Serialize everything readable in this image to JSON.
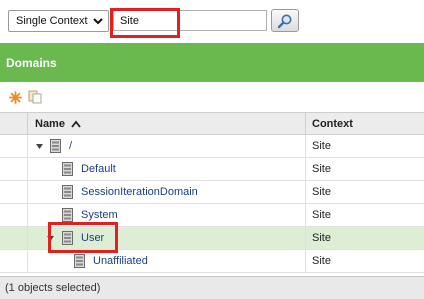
{
  "search": {
    "context_options": [
      "Single Context"
    ],
    "context_selected": "Single Context",
    "query_value": "Site",
    "button_icon": "magnifier-icon"
  },
  "panel": {
    "title": "Domains",
    "toolbar_icons": [
      "new-domain-icon",
      "copy-icon"
    ]
  },
  "table": {
    "columns": {
      "name": "Name",
      "context": "Context"
    },
    "sort": {
      "column": "Name",
      "direction": "ascending"
    },
    "rows": [
      {
        "name": "/",
        "context": "Site",
        "level": 0,
        "expanded": true,
        "selected": false
      },
      {
        "name": "Default",
        "context": "Site",
        "level": 1,
        "expanded": false,
        "selected": false
      },
      {
        "name": "SessionIterationDomain",
        "context": "Site",
        "level": 1,
        "expanded": false,
        "selected": false
      },
      {
        "name": "System",
        "context": "Site",
        "level": 1,
        "expanded": false,
        "selected": false
      },
      {
        "name": "User",
        "context": "Site",
        "level": 1,
        "expanded": true,
        "selected": true
      },
      {
        "name": "Unaffiliated",
        "context": "Site",
        "level": 2,
        "expanded": false,
        "selected": false
      }
    ]
  },
  "status": {
    "text": "(1 objects selected)"
  },
  "colors": {
    "header_green": "#6ab94e",
    "highlight_red": "#e0211f",
    "selected_row": "#ddeed5",
    "link_blue": "#1a3f86"
  }
}
